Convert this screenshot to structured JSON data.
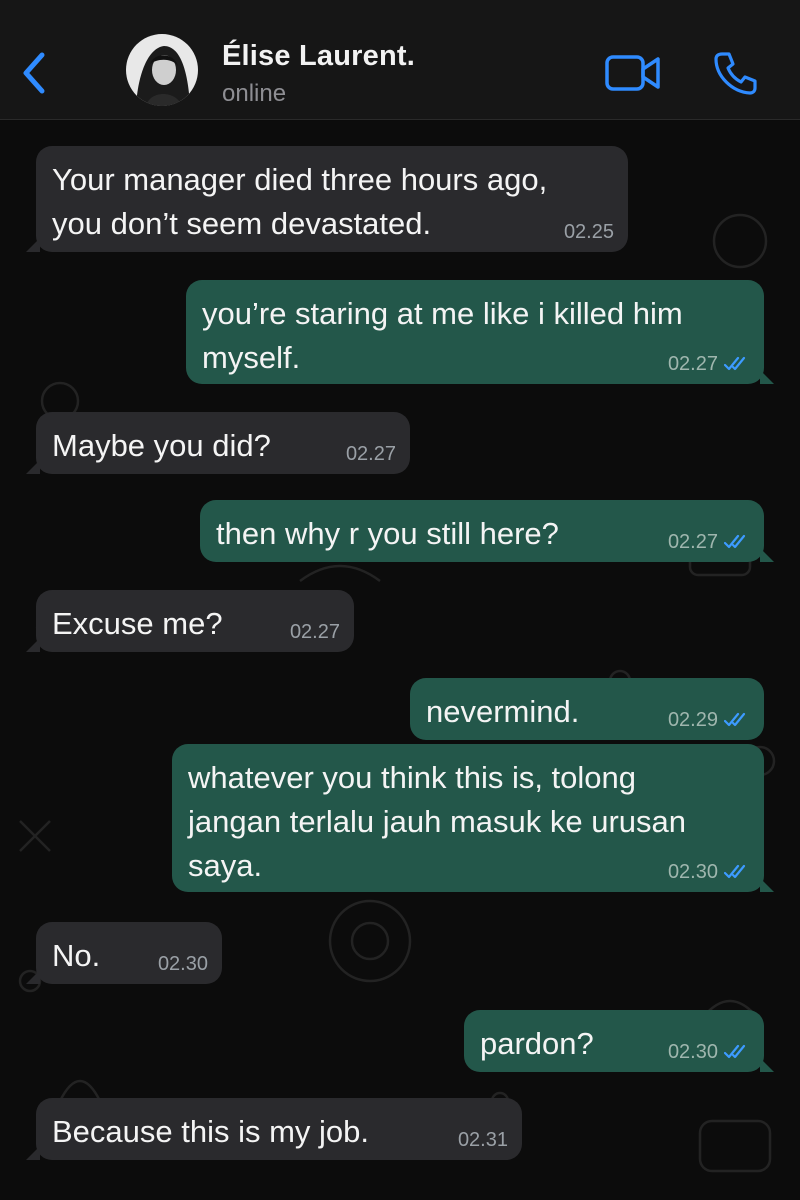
{
  "header": {
    "contact_name": "Élise Laurent.",
    "status": "online",
    "back_icon": "chevron-left-icon",
    "video_icon": "video-camera-icon",
    "call_icon": "phone-icon",
    "accent_color": "#2f8bff"
  },
  "messages": [
    {
      "direction": "in",
      "lines": [
        "Your manager died three hours ago,",
        "you don’t seem devastated."
      ],
      "time": "02.25"
    },
    {
      "direction": "out",
      "lines": [
        "you’re staring at me like i killed him",
        "myself."
      ],
      "time": "02.27",
      "read": true
    },
    {
      "direction": "in",
      "lines": [
        "Maybe you did?"
      ],
      "time": "02.27"
    },
    {
      "direction": "out",
      "lines": [
        "then why r you still here?"
      ],
      "time": "02.27",
      "read": true
    },
    {
      "direction": "in",
      "lines": [
        "Excuse me?"
      ],
      "time": "02.27"
    },
    {
      "direction": "out",
      "lines": [
        "nevermind."
      ],
      "time": "02.29",
      "read": true
    },
    {
      "direction": "out",
      "lines": [
        "whatever you think this is, tolong",
        "jangan terlalu jauh masuk ke urusan",
        "saya."
      ],
      "time": "02.30",
      "read": true
    },
    {
      "direction": "in",
      "lines": [
        "No."
      ],
      "time": "02.30"
    },
    {
      "direction": "out",
      "lines": [
        "pardon?"
      ],
      "time": "02.30",
      "read": true
    },
    {
      "direction": "in",
      "lines": [
        "Because this is my job."
      ],
      "time": "02.31"
    }
  ]
}
